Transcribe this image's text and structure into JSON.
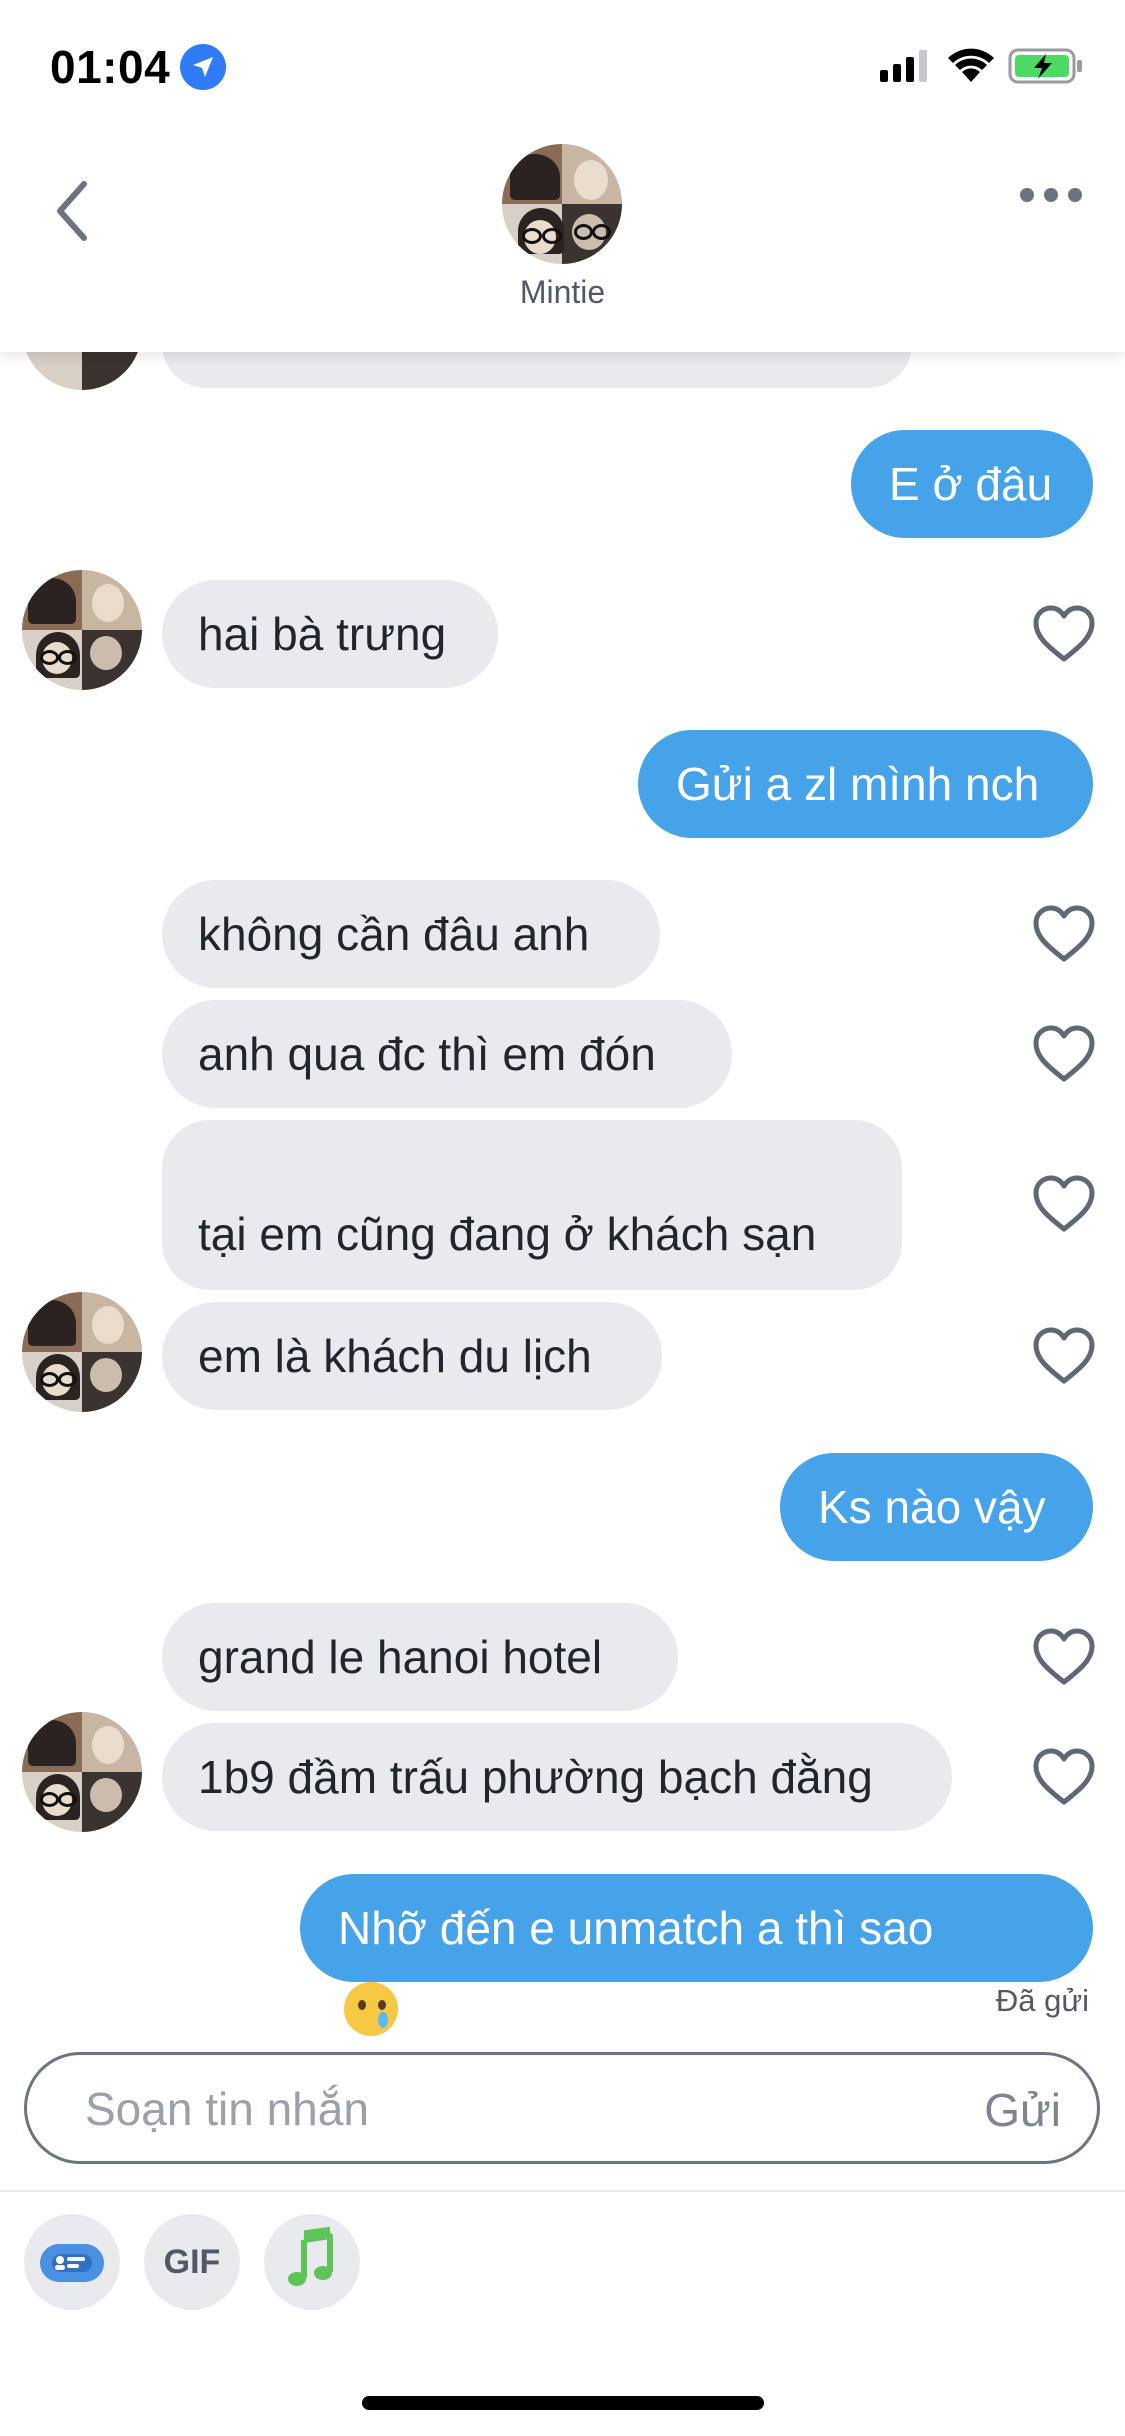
{
  "status_bar": {
    "time": "01:04"
  },
  "header": {
    "contact_name": "Mintie"
  },
  "messages": [
    {
      "side": "out",
      "text": "E ở đâu"
    },
    {
      "side": "in",
      "text": "hai bà trưng"
    },
    {
      "side": "out",
      "text": "Gửi a zl mình nch"
    },
    {
      "side": "in",
      "text": "không cần đâu anh"
    },
    {
      "side": "in",
      "text": "anh qua đc thì em đón"
    },
    {
      "side": "in",
      "text": "tại em cũng đang ở khách sạn"
    },
    {
      "side": "in",
      "text": "em là khách du lịch"
    },
    {
      "side": "out",
      "text": "Ks nào vậy"
    },
    {
      "side": "in",
      "text": "grand le hanoi hotel"
    },
    {
      "side": "in",
      "text": "1b9 đầm trấu phường bạch đằng"
    },
    {
      "side": "out",
      "text": "Nhỡ đến e unmatch a thì sao"
    }
  ],
  "sent_status": "Đã gửi",
  "composer": {
    "placeholder": "Soạn tin nhắn",
    "send_label": "Gửi"
  },
  "toolbar": {
    "gif_label": "GIF"
  },
  "colors": {
    "accent": "#46a3ea",
    "incoming_bubble": "#e9eaee",
    "music": "#5ec45a"
  }
}
